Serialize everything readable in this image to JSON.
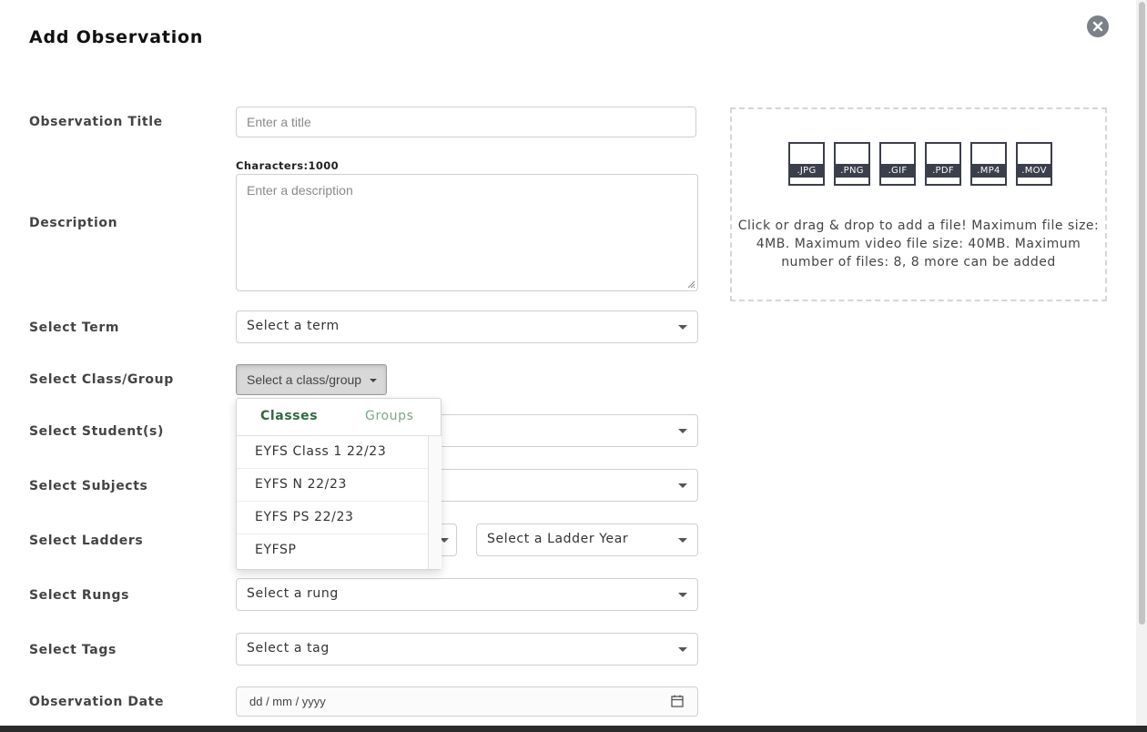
{
  "modal": {
    "title": "Add Observation"
  },
  "form": {
    "observation_title": {
      "label": "Observation Title",
      "placeholder": "Enter a title"
    },
    "description": {
      "label": "Description",
      "char_counter": "Characters:1000",
      "placeholder": "Enter a description"
    },
    "term": {
      "label": "Select Term",
      "value": "Select a term"
    },
    "class_group": {
      "label": "Select Class/Group",
      "button": "Select a class/group",
      "dropdown": {
        "tabs": [
          "Classes",
          "Groups"
        ],
        "active_tab": "Classes",
        "items": [
          "EYFS Class 1 22/23",
          "EYFS N 22/23",
          "EYFS PS 22/23",
          "EYFSP"
        ]
      }
    },
    "students": {
      "label": "Select Student(s)"
    },
    "subjects": {
      "label": "Select Subjects"
    },
    "ladders": {
      "label": "Select Ladders",
      "year_value": "Select a Ladder Year"
    },
    "rungs": {
      "label": "Select Rungs",
      "value": "Select a rung"
    },
    "tags": {
      "label": "Select Tags",
      "value": "Select a tag"
    },
    "date": {
      "label": "Observation Date",
      "value": "dd / mm / yyyy"
    }
  },
  "upload": {
    "file_types": [
      ".JPG",
      ".PNG",
      ".GIF",
      ".PDF",
      ".MP4",
      ".MOV"
    ],
    "instructions": "Click or drag & drop to add a file! Maximum file size: 4MB. Maximum video file size: 40MB. Maximum number of files: 8, 8 more can be added"
  },
  "colors": {
    "accent_green": "#2d6a3e",
    "file_icon": "#3a3f4b",
    "close_button": "#7b8089"
  },
  "icons": {
    "close": "close-circle-icon",
    "calendar": "calendar-icon",
    "resize": "resize-grip-icon"
  }
}
